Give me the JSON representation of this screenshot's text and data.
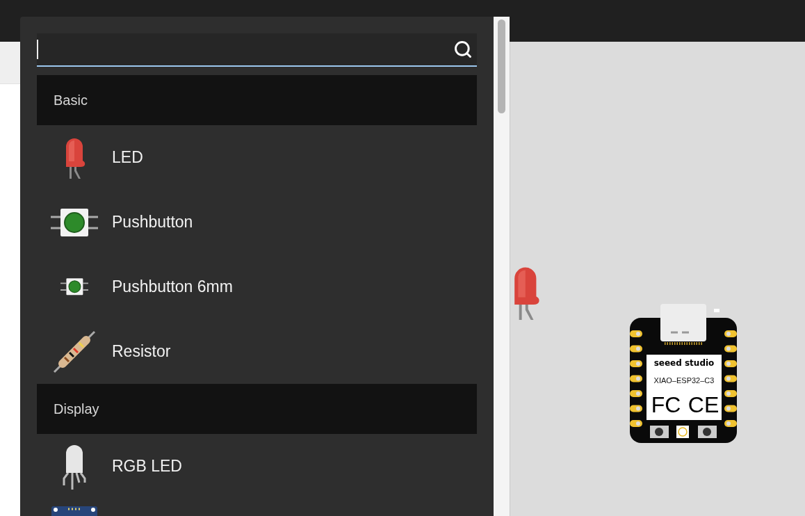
{
  "groups": [
    {
      "title": "Basic",
      "items": [
        {
          "kind": "led",
          "label": "LED"
        },
        {
          "kind": "pushbutton",
          "label": "Pushbutton"
        },
        {
          "kind": "pushbutton-small",
          "label": "Pushbutton 6mm"
        },
        {
          "kind": "resistor",
          "label": "Resistor"
        }
      ]
    },
    {
      "title": "Display",
      "items": [
        {
          "kind": "rgb-led",
          "label": "RGB LED"
        },
        {
          "kind": "lcd"
        }
      ]
    }
  ],
  "canvas": {
    "parts": [
      {
        "kind": "led"
      },
      {
        "kind": "board",
        "brand": "seeed studio",
        "model": "XIAO–ESP32–C3",
        "marks": [
          "FC",
          "CE"
        ]
      }
    ]
  }
}
